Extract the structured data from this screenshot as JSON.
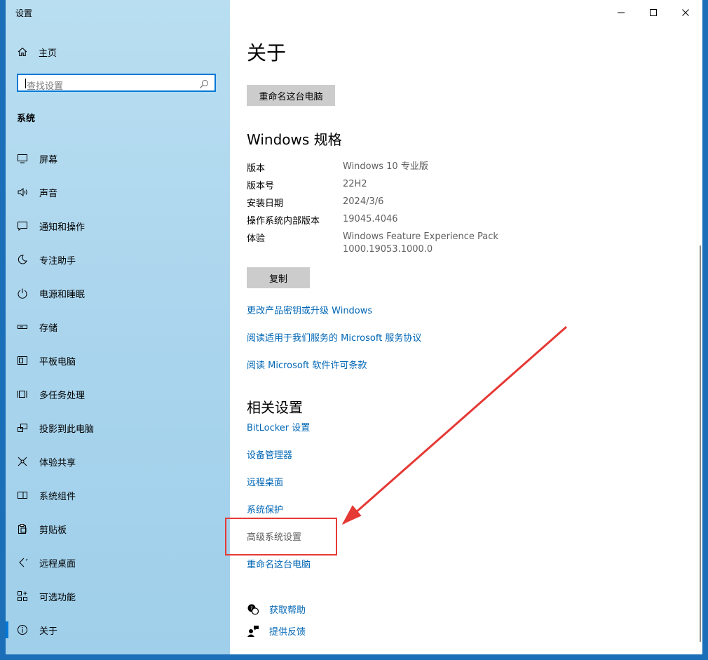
{
  "app": {
    "title": "设置"
  },
  "sidebar": {
    "home_label": "主页",
    "search_placeholder": "查找设置",
    "group_title": "系统",
    "items": [
      {
        "label": "屏幕",
        "icon": "monitor-icon"
      },
      {
        "label": "声音",
        "icon": "speaker-icon"
      },
      {
        "label": "通知和操作",
        "icon": "notification-icon"
      },
      {
        "label": "专注助手",
        "icon": "moon-icon"
      },
      {
        "label": "电源和睡眠",
        "icon": "power-icon"
      },
      {
        "label": "存储",
        "icon": "storage-icon"
      },
      {
        "label": "平板电脑",
        "icon": "tablet-icon"
      },
      {
        "label": "多任务处理",
        "icon": "multitask-icon"
      },
      {
        "label": "投影到此电脑",
        "icon": "project-icon"
      },
      {
        "label": "体验共享",
        "icon": "share-icon"
      },
      {
        "label": "系统组件",
        "icon": "components-icon"
      },
      {
        "label": "剪贴板",
        "icon": "clipboard-icon"
      },
      {
        "label": "远程桌面",
        "icon": "remote-icon"
      },
      {
        "label": "可选功能",
        "icon": "optional-features-icon"
      },
      {
        "label": "关于",
        "icon": "info-icon",
        "active": true
      }
    ]
  },
  "main": {
    "title": "关于",
    "rename_button": "重命名这台电脑",
    "specs_title": "Windows 规格",
    "specs": [
      {
        "label": "版本",
        "value": "Windows 10 专业版"
      },
      {
        "label": "版本号",
        "value": "22H2"
      },
      {
        "label": "安装日期",
        "value": "2024/3/6"
      },
      {
        "label": "操作系统内部版本",
        "value": "19045.4046"
      },
      {
        "label": "体验",
        "value": "Windows Feature Experience Pack",
        "value2": "1000.19053.1000.0"
      }
    ],
    "copy_button": "复制",
    "links": [
      "更改产品密钥或升级 Windows",
      "阅读适用于我们服务的 Microsoft 服务协议",
      "阅读 Microsoft 软件许可条款"
    ],
    "related_title": "相关设置",
    "related_links": [
      "BitLocker 设置",
      "设备管理器",
      "远程桌面",
      "系统保护",
      "高级系统设置",
      "重命名这台电脑"
    ],
    "help": {
      "get_help": "获取帮助",
      "feedback": "提供反馈"
    }
  },
  "colors": {
    "accent": "#0078d7",
    "link": "#0066b4",
    "annotation": "#e53935"
  }
}
